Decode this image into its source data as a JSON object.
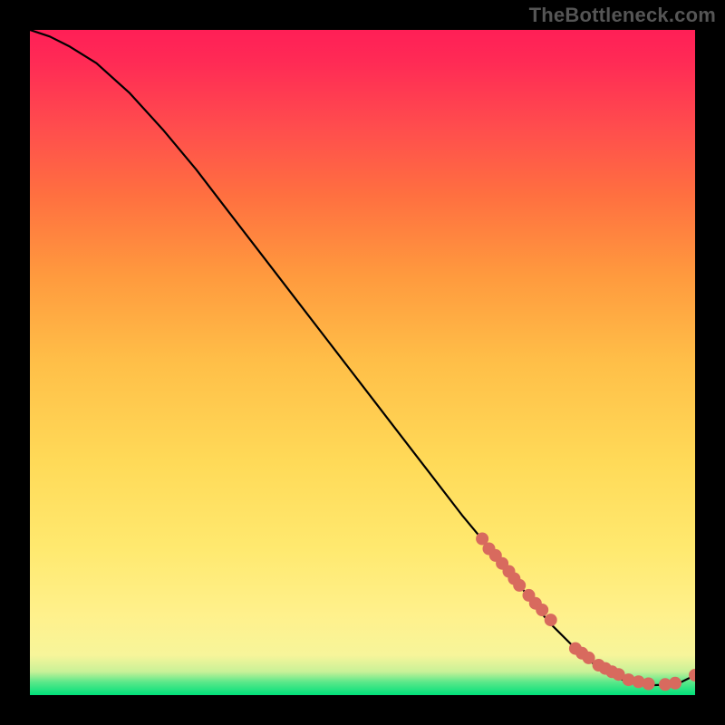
{
  "watermark": "TheBottleneck.com",
  "colors": {
    "background": "#000000",
    "curve": "#000000",
    "dot": "#d86a5e"
  },
  "chart_data": {
    "type": "line",
    "title": "",
    "xlabel": "",
    "ylabel": "",
    "xlim": [
      0,
      100
    ],
    "ylim": [
      0,
      100
    ],
    "grid": false,
    "legend": false,
    "series": [
      {
        "name": "bottleneck-curve",
        "x": [
          0,
          3,
          6,
          10,
          15,
          20,
          25,
          30,
          35,
          40,
          45,
          50,
          55,
          60,
          65,
          70,
          74,
          78,
          82,
          85,
          88,
          90,
          92,
          94,
          96,
          98,
          100
        ],
        "y": [
          100,
          99,
          97.5,
          95,
          90.5,
          85,
          79,
          72.5,
          66,
          59.5,
          53,
          46.5,
          40,
          33.5,
          27,
          21,
          16,
          11,
          7,
          4.5,
          2.7,
          2.0,
          1.6,
          1.5,
          1.6,
          2.0,
          3.0
        ]
      }
    ],
    "highlight_points": {
      "name": "highlight-dots",
      "x": [
        68,
        69,
        70,
        71,
        72,
        72.8,
        73.6,
        75,
        76,
        77,
        78.3,
        82,
        83,
        84,
        85.5,
        86.5,
        87.5,
        88.5,
        90,
        91.5,
        93,
        95.5,
        97,
        100
      ],
      "y": [
        23.5,
        22,
        21,
        19.8,
        18.6,
        17.5,
        16.5,
        15,
        13.8,
        12.8,
        11.3,
        7,
        6.3,
        5.6,
        4.5,
        4,
        3.5,
        3.1,
        2.3,
        2,
        1.7,
        1.6,
        1.8,
        3.0
      ]
    }
  }
}
